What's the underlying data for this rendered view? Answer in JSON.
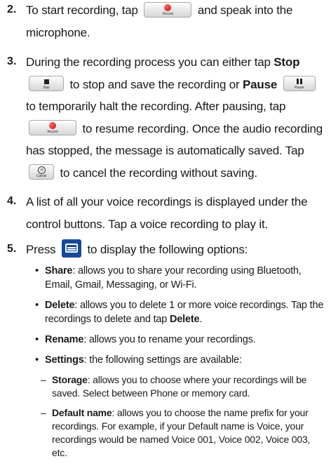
{
  "steps": [
    {
      "num": "2.",
      "t1": "To start recording, tap",
      "t2": "and speak into the microphone.",
      "record_caption": "Record"
    },
    {
      "num": "3.",
      "t1": "During the recording process you can either tap",
      "stop_bold": "Stop",
      "stop_caption": "Stop",
      "t2": "to stop and save the recording or",
      "pause_bold": "Pause",
      "pause_caption": "Pause",
      "t3": "to temporarily halt the recording. After pausing, tap",
      "record_caption": "Record",
      "t4": "to resume recording. Once the audio recording has stopped, the message is automatically saved. Tap",
      "cancel_caption": "Cancel",
      "t5": "to cancel the recording without saving."
    },
    {
      "num": "4.",
      "text": "A list of all your voice recordings is displayed under the control buttons. Tap a voice recording to play it."
    },
    {
      "num": "5.",
      "t1": "Press",
      "t2": "to display the following options:"
    }
  ],
  "bullets": [
    {
      "term": "Share",
      "text": ": allows you to share your recording using Bluetooth, Email, Gmail, Messaging, or Wi-Fi."
    },
    {
      "term": "Delete",
      "text": ": allows you to delete 1 or more voice recordings. Tap the recordings to delete and tap ",
      "term2": "Delete",
      "text2": "."
    },
    {
      "term": "Rename",
      "text": ": allows you to rename your recordings."
    },
    {
      "term": "Settings",
      "text": ": the following settings are available:"
    }
  ],
  "sub_bullets": [
    {
      "term": "Storage",
      "text": ": allows you to choose where your recordings will be saved. Select between Phone or memory card."
    },
    {
      "term": "Default name",
      "text": ": allows you to choose the name prefix for your recordings. For example, if your Default name is Voice, your recordings would be named Voice 001, Voice 002, Voice 003, etc."
    }
  ]
}
